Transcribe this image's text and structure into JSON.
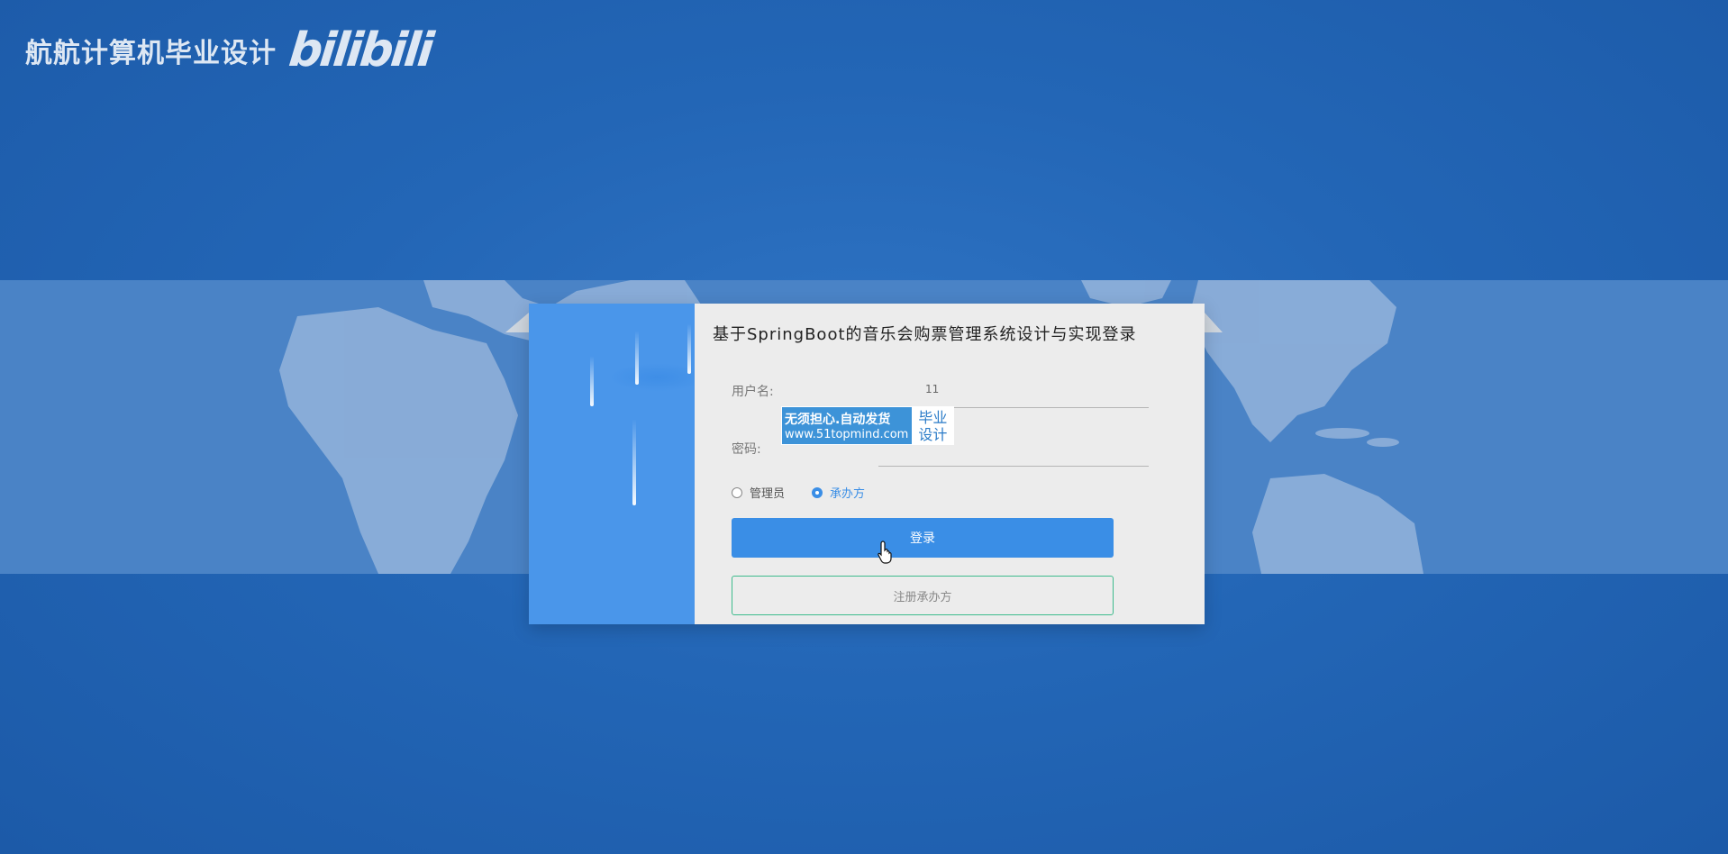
{
  "watermark": {
    "text": "航航计算机毕业设计",
    "logo": "bilibili"
  },
  "login": {
    "title": "基于SpringBoot的音乐会购票管理系统设计与实现登录",
    "username_label": "用户名:",
    "username_value": "11",
    "password_label": "密码:",
    "roles": [
      {
        "label": "管理员",
        "checked": false
      },
      {
        "label": "承办方",
        "checked": true
      }
    ],
    "login_button": "登录",
    "register_button": "注册承办方"
  },
  "stamp": {
    "line1": "无须担心.自动发货",
    "line2": "www.51topmind.com",
    "right1": "毕业",
    "right2": "设计"
  },
  "colors": {
    "background": "#2366b6",
    "map_band": "#4a83c6",
    "card_left": "#4a96ea",
    "primary": "#3a8ee6",
    "register_border": "#3dbb8c"
  },
  "icons": {
    "cursor": "hand-pointer-icon",
    "radio": "radio-icon"
  }
}
